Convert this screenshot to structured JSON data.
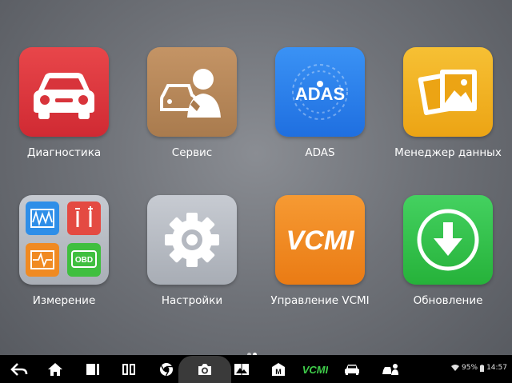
{
  "apps": [
    {
      "label": "Диагностика",
      "icon": "car-icon",
      "color": "#e0343c"
    },
    {
      "label": "Сервис",
      "icon": "mechanic-icon",
      "color": "#b98a5a"
    },
    {
      "label": "ADAS",
      "icon": "adas-icon",
      "icon_text": "ADAS",
      "color": "#2f86f0"
    },
    {
      "label": "Менеджер данных",
      "icon": "photos-icon",
      "color": "#f2b31e"
    },
    {
      "label": "Измерение",
      "icon": "measurement-icon",
      "icon_text": "OBD",
      "color": "#b7bcc4"
    },
    {
      "label": "Настройки",
      "icon": "gear-icon",
      "color": "#b8bcc4"
    },
    {
      "label": "Управление VCMI",
      "icon": "vcmi-icon",
      "icon_text": "VCMI",
      "color": "#f08a22"
    },
    {
      "label": "Обновление",
      "icon": "download-icon",
      "color": "#34c24a"
    }
  ],
  "page_indicator": {
    "count": 2,
    "active": 1
  },
  "navbar": {
    "buttons": [
      "back-icon",
      "home-icon",
      "recents-icon",
      "split-icon",
      "chrome-icon",
      "camera-icon",
      "gallery-icon",
      "maxifix-icon",
      "vcmi-icon",
      "car-icon",
      "mechanic-icon"
    ],
    "vcmi_text": "VCMI",
    "m_text": "M"
  },
  "status": {
    "battery": "95%",
    "time": "14:57"
  }
}
